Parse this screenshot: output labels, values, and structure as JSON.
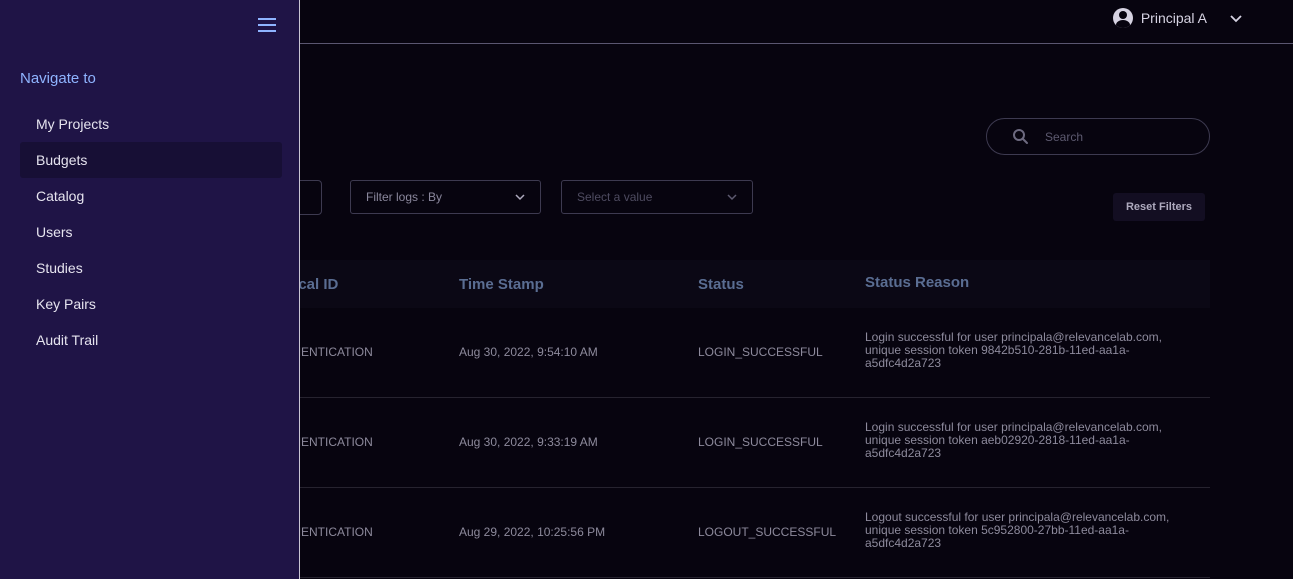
{
  "header": {
    "user_name": "Principal A"
  },
  "search": {
    "placeholder": "Search"
  },
  "filters": {
    "by_placeholder": "Filter logs : By",
    "value_placeholder": "Select a value",
    "reset_label": "Reset Filters"
  },
  "table": {
    "columns": [
      "gical ID",
      "Time Stamp",
      "Status",
      "Status Reason"
    ],
    "rows": [
      {
        "logical_id": "THENTICATION",
        "timestamp": "Aug 30, 2022, 9:54:10 AM",
        "status": "LOGIN_SUCCESSFUL",
        "reason_1": "Login successful for user principala@relevancelab.com,",
        "reason_2": "unique session token 9842b510-281b-11ed-aa1a-",
        "reason_3": "a5dfc4d2a723"
      },
      {
        "logical_id": "THENTICATION",
        "timestamp": "Aug 30, 2022, 9:33:19 AM",
        "status": "LOGIN_SUCCESSFUL",
        "reason_1": "Login successful for user principala@relevancelab.com,",
        "reason_2": "unique session token aeb02920-2818-11ed-aa1a-",
        "reason_3": "a5dfc4d2a723"
      },
      {
        "logical_id": "THENTICATION",
        "timestamp": "Aug 29, 2022, 10:25:56 PM",
        "status": "LOGOUT_SUCCESSFUL",
        "reason_1": "Logout successful for user principala@relevancelab.com,",
        "reason_2": "unique session token 5c952800-27bb-11ed-aa1a-",
        "reason_3": "a5dfc4d2a723"
      }
    ]
  },
  "sidebar": {
    "title": "Navigate to",
    "items": [
      {
        "label": "My Projects"
      },
      {
        "label": "Budgets"
      },
      {
        "label": "Catalog"
      },
      {
        "label": "Users"
      },
      {
        "label": "Studies"
      },
      {
        "label": "Key Pairs"
      },
      {
        "label": "Audit Trail"
      }
    ]
  },
  "colors": {
    "sidebar_bg": "#1f1446",
    "page_bg": "#07040f",
    "accent": "#8fb4ff"
  }
}
